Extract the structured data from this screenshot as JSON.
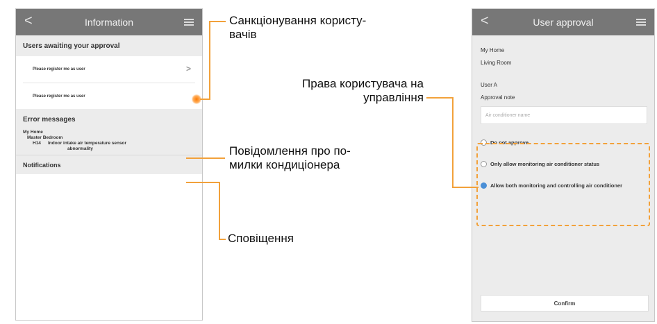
{
  "left_screen": {
    "title": "Information",
    "section_users": "Users awaiting your approval",
    "requests": [
      {
        "label": "Please register me as user"
      },
      {
        "label": "Please register me as user"
      }
    ],
    "section_errors": "Error messages",
    "error": {
      "home": "My Home",
      "room": "Master Bedroom",
      "code": "H14",
      "message_line1": "Indoor intake air temperature sensor",
      "message_line2": "abnormality"
    },
    "section_notifications": "Notifications"
  },
  "right_screen": {
    "title": "User approval",
    "home": "My Home",
    "room": "Living Room",
    "user": "User A",
    "approval_note_label": "Approval note",
    "note_placeholder": "Air conditioner name",
    "options": [
      {
        "label": "Do not approve",
        "selected": false
      },
      {
        "label": "Only allow monitoring air conditioner status",
        "selected": false
      },
      {
        "label": "Allow both monitoring and controlling air conditioner",
        "selected": true
      }
    ],
    "confirm_label": "Confirm"
  },
  "annotations": {
    "user_approval_line1": "Санкціонування користу-",
    "user_approval_line2": "вачів",
    "control_rights_line1": "Права користувача на",
    "control_rights_line2": "управління",
    "error_msgs_line1": "Повідомлення про по-",
    "error_msgs_line2": "милки кондиціонера",
    "notifications": "Сповіщення"
  },
  "colors": {
    "accent": "#f2a13a",
    "selected_radio": "#4a8fd6",
    "topbar": "#777777"
  }
}
